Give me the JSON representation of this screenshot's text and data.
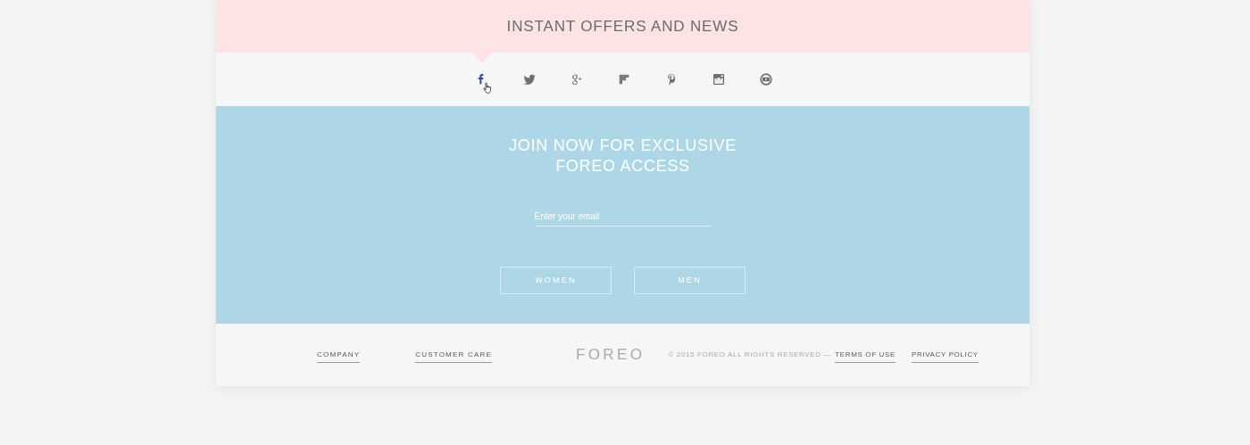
{
  "header": {
    "title": "INSTANT OFFERS AND NEWS"
  },
  "social_links": [
    {
      "kind": "facebook",
      "hovered": true
    },
    {
      "kind": "twitter",
      "hovered": false
    },
    {
      "kind": "google_plus",
      "hovered": false
    },
    {
      "kind": "flipboard",
      "hovered": false
    },
    {
      "kind": "pinterest",
      "hovered": false
    },
    {
      "kind": "instagram",
      "hovered": false
    },
    {
      "kind": "youtube",
      "hovered": false
    }
  ],
  "signup": {
    "title_lines": [
      "JOIN NOW FOR EXCLUSIVE",
      "FOREO ACCESS"
    ],
    "email": {
      "placeholder": "Enter your email"
    },
    "buttons": [
      "WOMEN",
      "MEN"
    ]
  },
  "footer": {
    "links": [
      "COMPANY",
      "CUSTOMER CARE"
    ],
    "logo": "FOREO",
    "copyright": "© 2015 FOREO ALL RIGHTS RESERVED —",
    "legal_links": [
      "TERMS OF USE",
      "PRIVACY POLICY"
    ]
  }
}
